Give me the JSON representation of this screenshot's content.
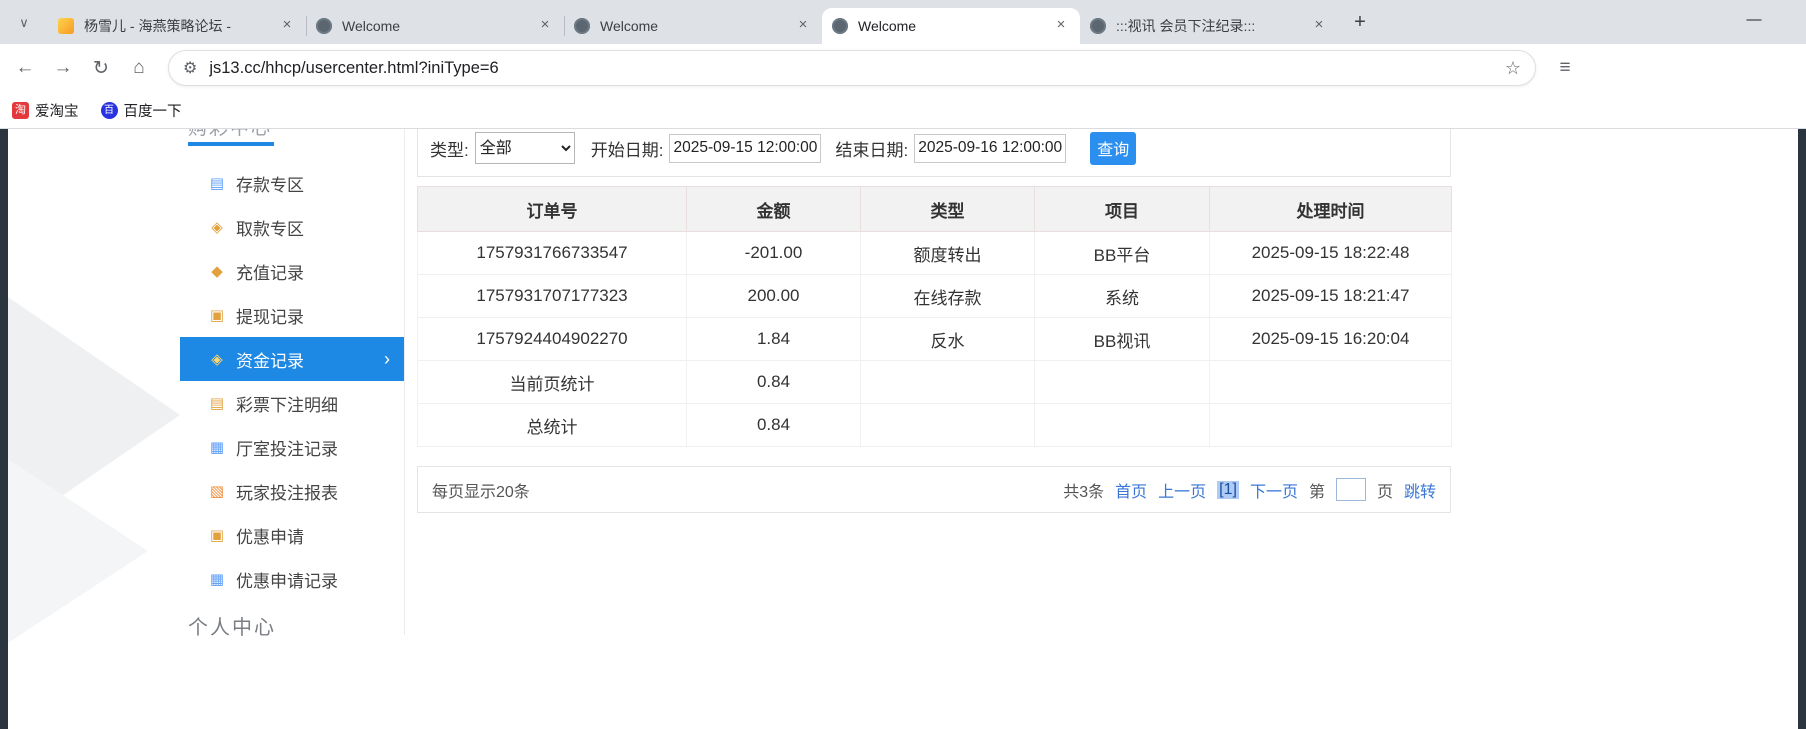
{
  "browser": {
    "tabs": [
      {
        "title": "杨雪儿 - 海燕策略论坛 -",
        "favicon": "forum-favicon"
      },
      {
        "title": "Welcome",
        "favicon": "globe-favicon"
      },
      {
        "title": "Welcome",
        "favicon": "globe-favicon"
      },
      {
        "title": "Welcome",
        "favicon": "globe-favicon",
        "active": true
      },
      {
        "title": ":::视讯 会员下注纪录:::",
        "favicon": "globe-favicon"
      }
    ],
    "url": "js13.cc/hhcp/usercenter.html?iniType=6",
    "bookmarks": [
      {
        "label": "爱淘宝",
        "icon_text": "淘"
      },
      {
        "label": "百度一下",
        "icon_text": "百"
      }
    ]
  },
  "icons": {
    "chevron_down": "∨",
    "close": "×",
    "plus": "+",
    "minimize": "—",
    "back": "←",
    "forward": "→",
    "reload": "↻",
    "home": "⌂",
    "tune": "⚙",
    "star": "☆",
    "menu": "≡",
    "chevron_right": "›"
  },
  "sidebar": {
    "header": "购彩中心",
    "items": [
      {
        "label": "存款专区",
        "icon": "▤"
      },
      {
        "label": "取款专区",
        "icon": "◈"
      },
      {
        "label": "充值记录",
        "icon": "◆"
      },
      {
        "label": "提现记录",
        "icon": "▣"
      },
      {
        "label": "资金记录",
        "icon": "◈",
        "active": true
      },
      {
        "label": "彩票下注明细",
        "icon": "▤"
      },
      {
        "label": "厅室投注记录",
        "icon": "▦"
      },
      {
        "label": "玩家投注报表",
        "icon": "▧"
      },
      {
        "label": "优惠申请",
        "icon": "▣"
      },
      {
        "label": "优惠申请记录",
        "icon": "▦"
      }
    ],
    "footer": "个人中心"
  },
  "filters": {
    "type_label": "类型:",
    "type_value": "全部",
    "start_label": "开始日期:",
    "start_value": "2025-09-15 12:00:00",
    "end_label": "结束日期:",
    "end_value": "2025-09-16 12:00:00",
    "search_button": "查询"
  },
  "table": {
    "headers": [
      "订单号",
      "金额",
      "类型",
      "项目",
      "处理时间"
    ],
    "rows": [
      [
        "1757931766733547",
        "-201.00",
        "额度转出",
        "BB平台",
        "2025-09-15 18:22:48"
      ],
      [
        "1757931707177323",
        "200.00",
        "在线存款",
        "系统",
        "2025-09-15 18:21:47"
      ],
      [
        "1757924404902270",
        "1.84",
        "反水",
        "BB视讯",
        "2025-09-15 16:20:04"
      ],
      [
        "当前页统计",
        "0.84",
        "",
        "",
        ""
      ],
      [
        "总统计",
        "0.84",
        "",
        "",
        ""
      ]
    ]
  },
  "pagination": {
    "per_page": "每页显示20条",
    "total": "共3条",
    "first": "首页",
    "prev": "上一页",
    "current": "[1]",
    "next": "下一页",
    "jump_before": "第",
    "jump_after": "页",
    "jump": "跳转"
  },
  "colors": {
    "accent_blue": "#1e88e5",
    "link_blue": "#3a77d6",
    "query_button": "#2b8ff0",
    "taobao_red": "#e4393c",
    "baidu_blue": "#2932e1"
  }
}
